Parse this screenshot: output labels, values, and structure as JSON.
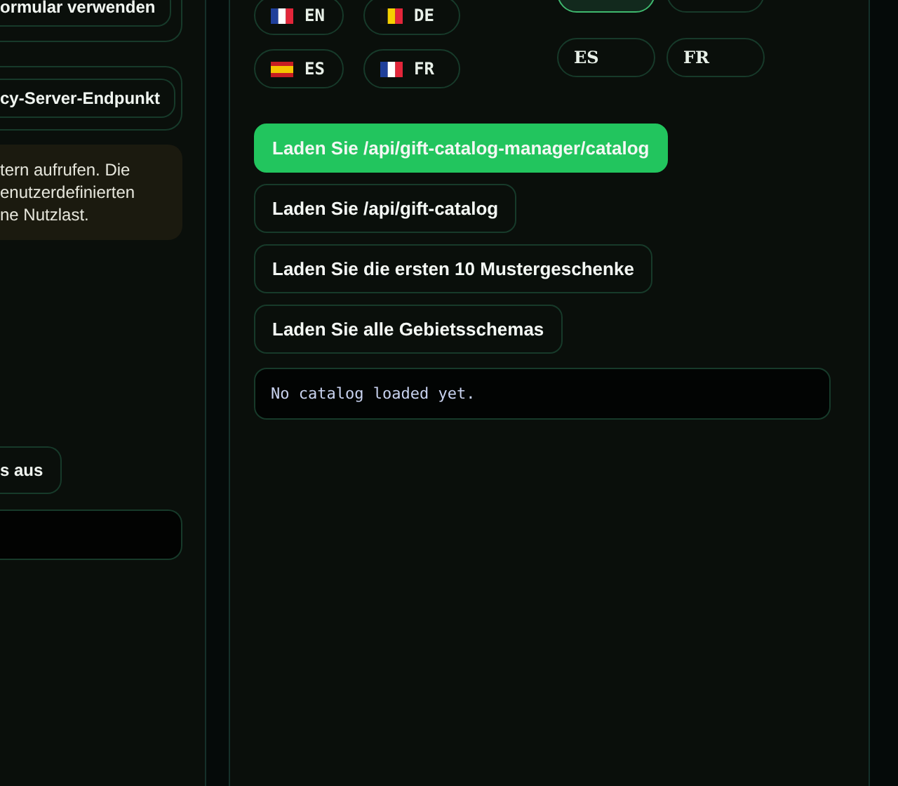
{
  "left_panel": {
    "form_card": {
      "button": "ormular verwenden"
    },
    "endpoint_card": {
      "button": "cy-Server-Endpunkt"
    },
    "notice": {
      "lines": [
        "tern aufrufen. Die",
        "enutzerdefinierten",
        "ne Nutzlast."
      ]
    },
    "action_button": "s aus"
  },
  "main_panel": {
    "language_group_1": [
      {
        "label": "EN",
        "kind": "french",
        "selected": false
      },
      {
        "label": "DE",
        "kind": "belgian",
        "selected": false
      },
      {
        "label": "ES",
        "kind": "spanish",
        "selected": false
      },
      {
        "label": "FR",
        "kind": "french",
        "selected": false
      }
    ],
    "language_group_2": [
      {
        "selected": true
      },
      {
        "selected": false
      },
      {
        "label": "ES",
        "selected": false
      },
      {
        "label": "FR",
        "selected": false
      }
    ],
    "load_buttons": [
      {
        "label": "Laden Sie /api/gift-catalog-manager/catalog",
        "selected": true
      },
      {
        "label": "Laden Sie /api/gift-catalog",
        "selected": false
      },
      {
        "label": "Laden Sie die ersten 10 Mustergeschenke",
        "selected": false
      },
      {
        "label": "Laden Sie alle Gebietsschemas",
        "selected": false
      }
    ],
    "output": "No catalog loaded yet."
  }
}
